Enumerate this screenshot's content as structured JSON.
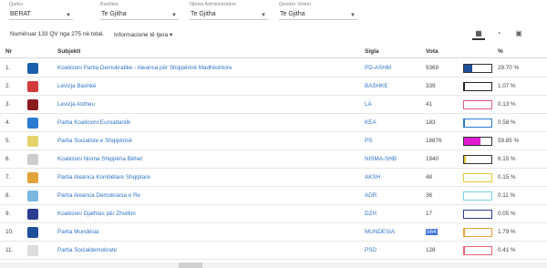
{
  "filters": [
    {
      "label": "Qarku",
      "value": "BERAT"
    },
    {
      "label": "Bashkia",
      "value": "Te Gjitha"
    },
    {
      "label": "Njësia Administrative",
      "value": "Te Gjitha"
    },
    {
      "label": "Qender Votimi",
      "value": "Te Gjitha"
    }
  ],
  "info": {
    "counted": "Numëruar 133 QV nga 275 në total.",
    "more": "Informacione të tjera ▾"
  },
  "view_icons": [
    "table-icon",
    "pie-chart-icon",
    "image-icon"
  ],
  "table": {
    "headers": {
      "nr": "Nr",
      "subjekti": "Subjekti",
      "sigla": "Sigla",
      "vota": "Vota",
      "pct": "%"
    },
    "rows": [
      {
        "nr": "1.",
        "name": "Koalicioni Partia Demokratike - Aleanca për Shqipërinë Madhështore",
        "sigla": "PD-ASHM",
        "vota": "9369",
        "pct": "29.70 %",
        "share": 29.7,
        "color": "#1f4e9b",
        "logo": "#1c5fae"
      },
      {
        "nr": "2.",
        "name": "Levizja Bashkë",
        "sigla": "BASHKE",
        "vota": "339",
        "pct": "1.07 %",
        "share": 1.07,
        "color": "#222222",
        "logo": "#d23b3b"
      },
      {
        "nr": "3.",
        "name": "Levizja Atdheu",
        "sigla": "LA",
        "vota": "41",
        "pct": "0.13 %",
        "share": 0.13,
        "color": "#e05a7a",
        "logo": "#8a1c1c"
      },
      {
        "nr": "4.",
        "name": "Partia Koalicioni Euroatlantik",
        "sigla": "KEA",
        "vota": "183",
        "pct": "0.58 %",
        "share": 0.58,
        "color": "#2b7bd1",
        "logo": "#2b7bd1"
      },
      {
        "nr": "5.",
        "name": "Partia Socialiste e Shqipërisë",
        "sigla": "PS",
        "vota": "18876",
        "pct": "59.85 %",
        "share": 59.85,
        "color": "#e01bd1",
        "logo": "#e3d36a"
      },
      {
        "nr": "6.",
        "name": "Koalicioni Nisma Shqipëria Bëhet",
        "sigla": "NISMA-SHB",
        "vota": "1940",
        "pct": "6.15 %",
        "share": 6.15,
        "color": "#e3c93a",
        "logo": "#cccccc"
      },
      {
        "nr": "7.",
        "name": "Partia Aleanca Kombëtare Shqiptare",
        "sigla": "AKSH",
        "vota": "48",
        "pct": "0.15 %",
        "share": 0.15,
        "color": "#e3c93a",
        "logo": "#e3a23a"
      },
      {
        "nr": "8.",
        "name": "Partia Aleanca Demokracia e Re",
        "sigla": "ADR",
        "vota": "36",
        "pct": "0.11 %",
        "share": 0.11,
        "color": "#7ad1e8",
        "logo": "#7ab8e0"
      },
      {
        "nr": "9.",
        "name": "Koalicioni Djathtas për Zhvillim",
        "sigla": "DZH",
        "vota": "17",
        "pct": "0.05 %",
        "share": 0.05,
        "color": "#2a3d8f",
        "logo": "#2a3d8f"
      },
      {
        "nr": "10.",
        "name": "Partia Mundësia",
        "sigla": "MUNDESIA",
        "vota": "564",
        "pct": "1.79 %",
        "share": 1.79,
        "color": "#e3a23a",
        "logo": "#1f4e9b"
      },
      {
        "nr": "11.",
        "name": "Partia Socialdemokrate",
        "sigla": "PSD",
        "vota": "128",
        "pct": "0.41 %",
        "share": 0.41,
        "color": "#e8637a",
        "logo": "#dddddd"
      }
    ]
  }
}
